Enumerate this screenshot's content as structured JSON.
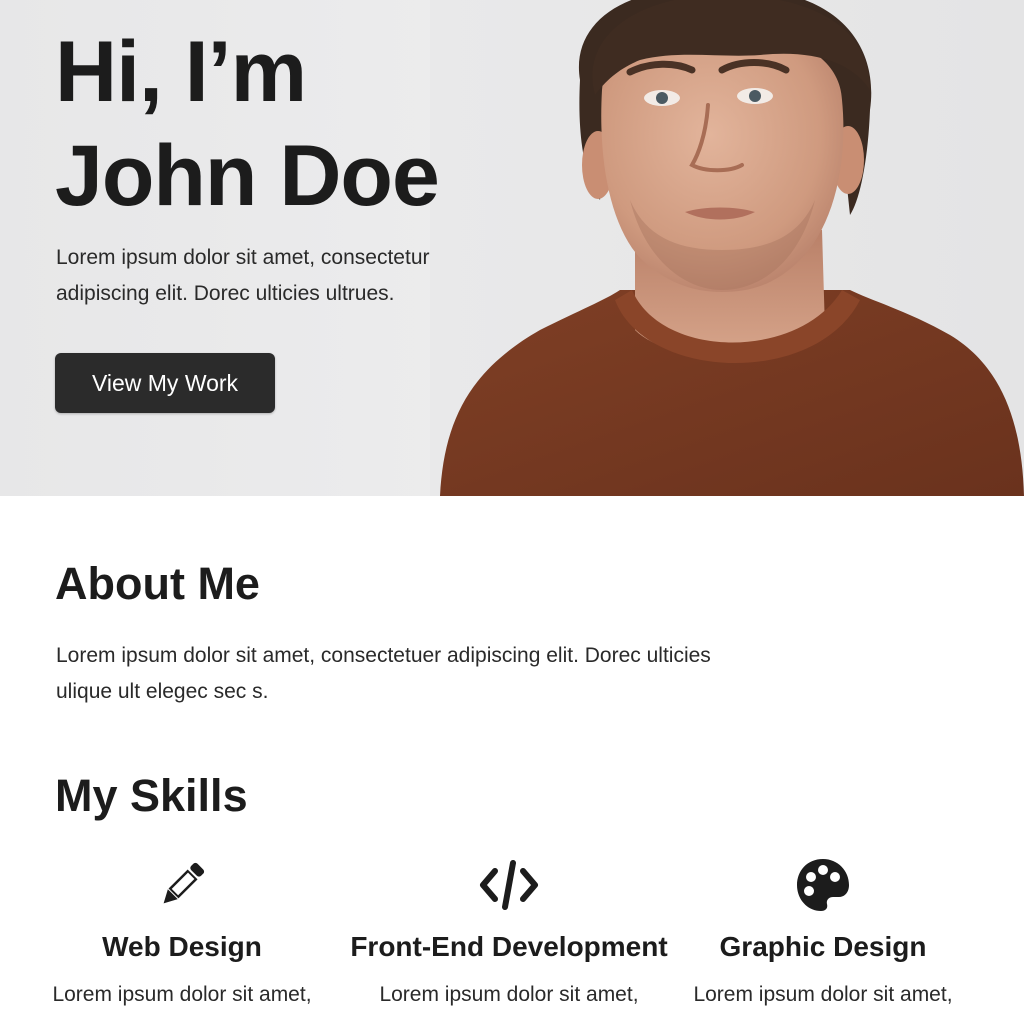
{
  "hero": {
    "title_line1": "Hi, I’m",
    "title_line2": "John Doe",
    "description": "Lorem ipsum dolor sit amet, consectetur adipiscing elit. Dorec ulticies ultrues.",
    "button_label": "View My Work",
    "photo_icon": "portrait-photo"
  },
  "about": {
    "title": "About Me",
    "text": "Lorem ipsum dolor sit amet, consectetuer adipiscing elit. Dorec ulticies ulique ult elegec sec s."
  },
  "skills": {
    "title": "My Skills",
    "items": [
      {
        "icon": "pencil-icon",
        "title": "Web Design",
        "text": "Lorem ipsum dolor sit amet,"
      },
      {
        "icon": "code-icon",
        "title": "Front-End Development",
        "text": "Lorem ipsum dolor sit amet,"
      },
      {
        "icon": "palette-icon",
        "title": "Graphic Design",
        "text": "Lorem ipsum dolor sit amet,"
      }
    ]
  },
  "colors": {
    "hero_background": "#e9e9ea",
    "button_background": "#2b2b2b",
    "sweater": "#7a3b22",
    "text_dark": "#1c1c1c"
  }
}
